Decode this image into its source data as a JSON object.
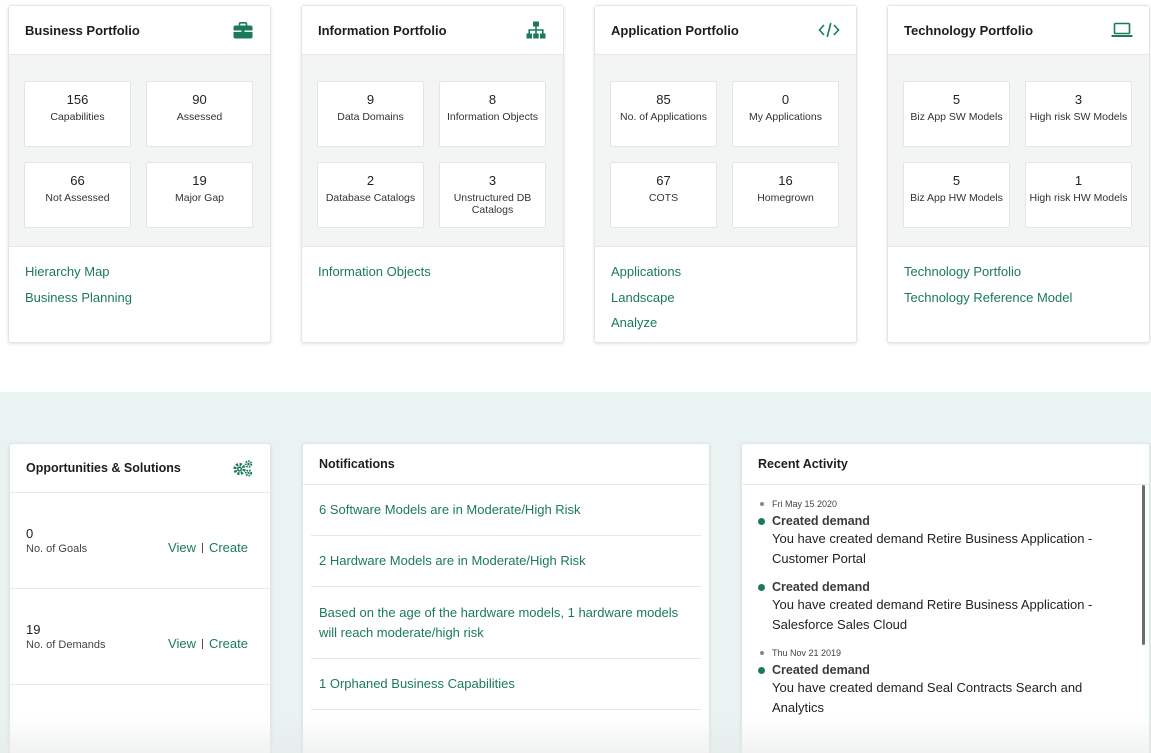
{
  "portfolios": [
    {
      "title": "Business Portfolio",
      "icon": "briefcase-icon",
      "stats": [
        {
          "value": "156",
          "label": "Capabilities"
        },
        {
          "value": "90",
          "label": "Assessed"
        },
        {
          "value": "66",
          "label": "Not Assessed"
        },
        {
          "value": "19",
          "label": "Major Gap"
        }
      ],
      "links": [
        "Hierarchy Map",
        "Business Planning"
      ]
    },
    {
      "title": "Information Portfolio",
      "icon": "hierarchy-icon",
      "stats": [
        {
          "value": "9",
          "label": "Data Domains"
        },
        {
          "value": "8",
          "label": "Information Objects"
        },
        {
          "value": "2",
          "label": "Database Catalogs"
        },
        {
          "value": "3",
          "label": "Unstructured DB Catalogs"
        }
      ],
      "links": [
        "Information Objects"
      ]
    },
    {
      "title": "Application Portfolio",
      "icon": "code-icon",
      "stats": [
        {
          "value": "85",
          "label": "No. of Applications"
        },
        {
          "value": "0",
          "label": "My Applications"
        },
        {
          "value": "67",
          "label": "COTS"
        },
        {
          "value": "16",
          "label": "Homegrown"
        }
      ],
      "links": [
        "Applications",
        "Landscape",
        "Analyze"
      ]
    },
    {
      "title": "Technology Portfolio",
      "icon": "laptop-icon",
      "stats": [
        {
          "value": "5",
          "label": "Biz App SW Models"
        },
        {
          "value": "3",
          "label": "High risk SW Models"
        },
        {
          "value": "5",
          "label": "Biz App HW Models"
        },
        {
          "value": "1",
          "label": "High risk HW Models"
        }
      ],
      "links": [
        "Technology Portfolio",
        "Technology Reference Model"
      ]
    }
  ],
  "opportunities": {
    "title": "Opportunities & Solutions",
    "icon": "gears-icon",
    "rows": [
      {
        "value": "0",
        "label": "No. of Goals",
        "view": "View",
        "create": "Create"
      },
      {
        "value": "19",
        "label": "No. of Demands",
        "view": "View",
        "create": "Create"
      }
    ]
  },
  "notifications": {
    "title": "Notifications",
    "items": [
      "6 Software Models are in Moderate/High Risk",
      "2 Hardware Models are in Moderate/High Risk",
      "Based on the age of the hardware models, 1 hardware models will reach moderate/high risk",
      "1 Orphaned Business Capabilities"
    ]
  },
  "recent_activity": {
    "title": "Recent Activity",
    "groups": [
      {
        "date": "Fri May 15 2020",
        "items": [
          {
            "title": "Created demand",
            "text": "You have created demand Retire Business Application - Customer Portal"
          },
          {
            "title": "Created demand",
            "text": "You have created demand Retire Business Application - Salesforce Sales Cloud"
          }
        ]
      },
      {
        "date": "Thu Nov 21 2019",
        "items": [
          {
            "title": "Created demand",
            "text": "You have created demand Seal Contracts Search and Analytics"
          }
        ]
      }
    ]
  },
  "colors": {
    "link": "#1b7a5e",
    "accent_icon": "#1b7a5e",
    "band_bg": "#e9f3f2"
  }
}
